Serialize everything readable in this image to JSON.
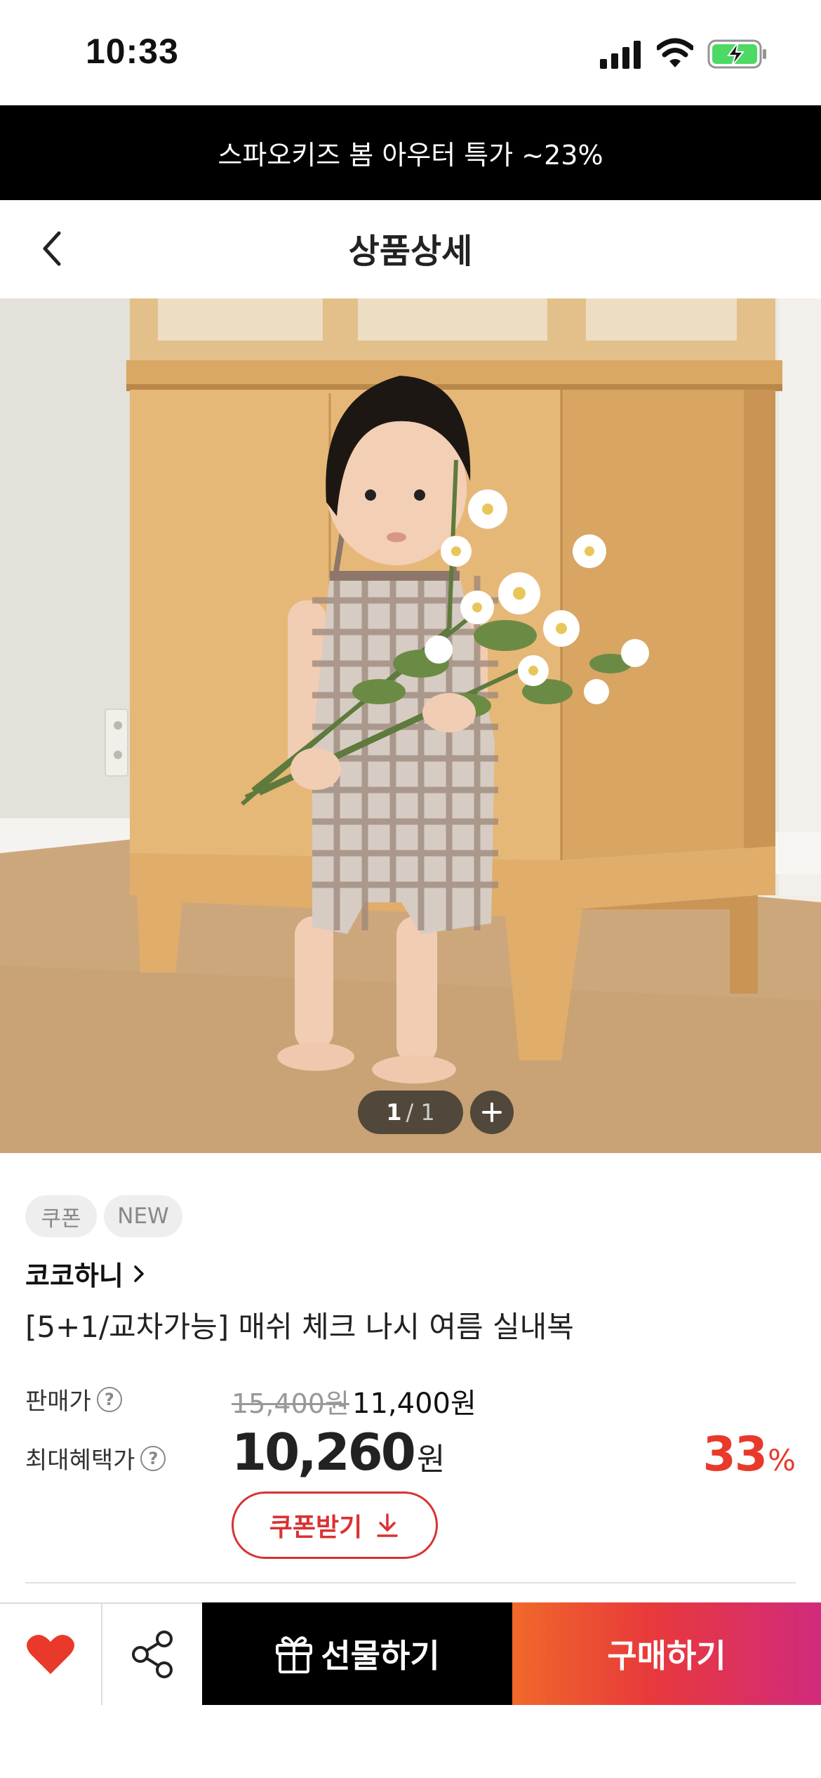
{
  "status_bar": {
    "time": "10:33"
  },
  "promo_banner": {
    "text": "스파오키즈 봄 아우터 특가 ~23%"
  },
  "nav": {
    "title": "상품상세"
  },
  "gallery": {
    "current": "1",
    "total": "/ 1"
  },
  "badges": [
    "쿠폰",
    "NEW"
  ],
  "product": {
    "brand": "코코하니",
    "title": "[5+1/교차가능] 매쉬 체크 나시 여름 실내복",
    "sale_price_label": "판매가",
    "original_price": "15,400원",
    "sale_price": "11,400원",
    "max_benefit_label": "최대혜택가",
    "max_benefit_price": "10,260",
    "max_benefit_unit": "원",
    "discount_value": "33",
    "discount_unit": "%",
    "help_symbol": "?"
  },
  "coupon_button": {
    "label": "쿠폰받기"
  },
  "bottom_bar": {
    "gift_label": "선물하기",
    "buy_label": "구매하기"
  },
  "colors": {
    "accent_red": "#e8392b",
    "buy_gradient_start": "#f0692a",
    "buy_gradient_end": "#d12a7d",
    "banner_bg": "#000000"
  },
  "icons": [
    "back-chevron-icon",
    "plus-icon",
    "help-icon",
    "chevron-right-icon",
    "download-icon",
    "heart-icon",
    "share-icon",
    "gift-icon",
    "signal-icon",
    "wifi-icon",
    "battery-charging-icon"
  ]
}
